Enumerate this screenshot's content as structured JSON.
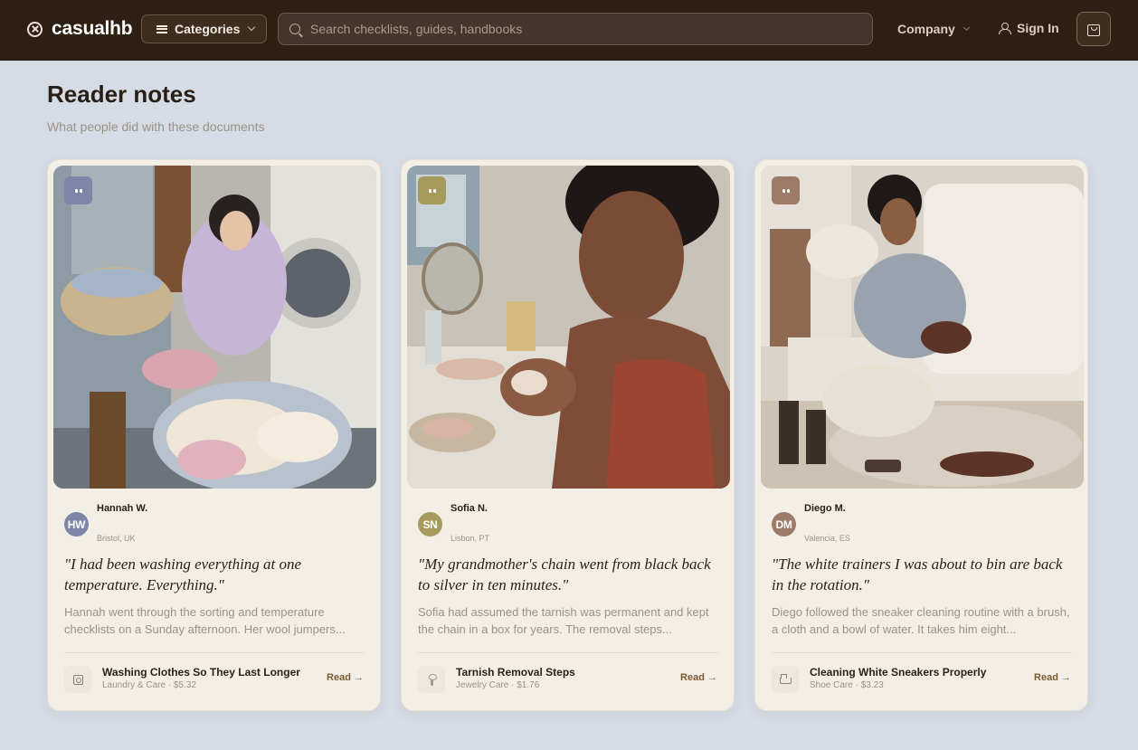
{
  "brand": {
    "name": "casualhb"
  },
  "nav": {
    "categories_label": "Categories",
    "search_placeholder": "Search checklists, guides, handbooks",
    "company_label": "Company",
    "sign_in_label": "Sign In"
  },
  "section": {
    "title": "Reader notes",
    "subtitle": "What people did with these documents"
  },
  "cards": [
    {
      "initials": "HW",
      "name": "Hannah W.",
      "location": "Bristol, UK",
      "avatar_color": "#7d86a8",
      "badge_color": "#7d86a8",
      "quote": "\"I had been washing everything at one temperature. Everything.\"",
      "description": "Hannah went through the sorting and temperature checklists on a Sunday afternoon. Her wool jumpers...",
      "doc_title": "Washing Clothes So They Last Longer",
      "doc_meta": "Laundry & Care · $5.32",
      "doc_icon": "washing-machine-icon",
      "read_label": "Read →"
    },
    {
      "initials": "SN",
      "name": "Sofia N.",
      "location": "Lisbon, PT",
      "avatar_color": "#a69a5c",
      "badge_color": "#a69a5c",
      "quote": "\"My grandmother's chain went from black back to silver in ten minutes.\"",
      "description": "Sofia had assumed the tarnish was permanent and kept the chain in a box for years. The removal steps...",
      "doc_title": "Tarnish Removal Steps",
      "doc_meta": "Jewelry Care · $1.76",
      "doc_icon": "pendant-icon",
      "read_label": "Read →"
    },
    {
      "initials": "DM",
      "name": "Diego M.",
      "location": "Valencia, ES",
      "avatar_color": "#9c7b68",
      "badge_color": "#9c7b68",
      "quote": "\"The white trainers I was about to bin are back in the rotation.\"",
      "description": "Diego followed the sneaker cleaning routine with a brush, a cloth and a bowl of water. It takes him eight...",
      "doc_title": "Cleaning White Sneakers Properly",
      "doc_meta": "Shoe Care · $3.23",
      "doc_icon": "shoe-icon",
      "read_label": "Read →"
    }
  ]
}
